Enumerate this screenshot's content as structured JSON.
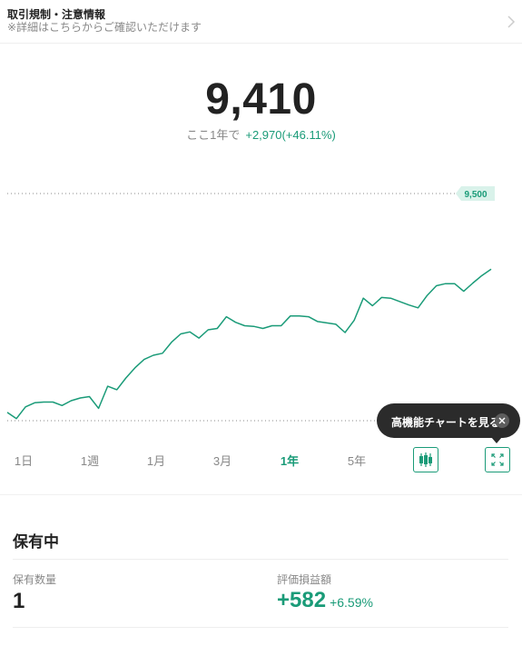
{
  "notice": {
    "title": "取引規制・注意情報",
    "subtitle": "※詳細はこちらからご確認いただけます"
  },
  "quote": {
    "price": "9,410",
    "change_label": "ここ1年で",
    "change_value": "+2,970(+46.11%)"
  },
  "chart_data": {
    "type": "line",
    "title": "",
    "color": "#1a9b78",
    "high_label": "9,500",
    "y_range": [
      6200,
      9500
    ],
    "values": [
      6320,
      6230,
      6400,
      6460,
      6470,
      6470,
      6420,
      6490,
      6530,
      6550,
      6380,
      6700,
      6650,
      6820,
      6970,
      7090,
      7150,
      7180,
      7340,
      7460,
      7490,
      7400,
      7520,
      7540,
      7710,
      7630,
      7580,
      7570,
      7540,
      7580,
      7580,
      7720,
      7720,
      7710,
      7640,
      7620,
      7600,
      7480,
      7660,
      7980,
      7870,
      7990,
      7980,
      7930,
      7880,
      7840,
      8020,
      8160,
      8190,
      8190,
      8080,
      8200,
      8310,
      8400
    ]
  },
  "tooltip": {
    "text": "高機能チャートを見る"
  },
  "ranges": [
    {
      "label": "1日",
      "active": false
    },
    {
      "label": "1週",
      "active": false
    },
    {
      "label": "1月",
      "active": false
    },
    {
      "label": "3月",
      "active": false
    },
    {
      "label": "1年",
      "active": true
    },
    {
      "label": "5年",
      "active": false
    }
  ],
  "icons": {
    "candlestick": "candlestick-icon",
    "expand": "expand-icon",
    "close": "close-icon",
    "chevron": "chevron-right-icon"
  },
  "holding": {
    "title": "保有中",
    "qty_label": "保有数量",
    "qty_value": "1",
    "pnl_label": "評価損益額",
    "pnl_value": "+582",
    "pnl_pct": "+6.59%"
  }
}
